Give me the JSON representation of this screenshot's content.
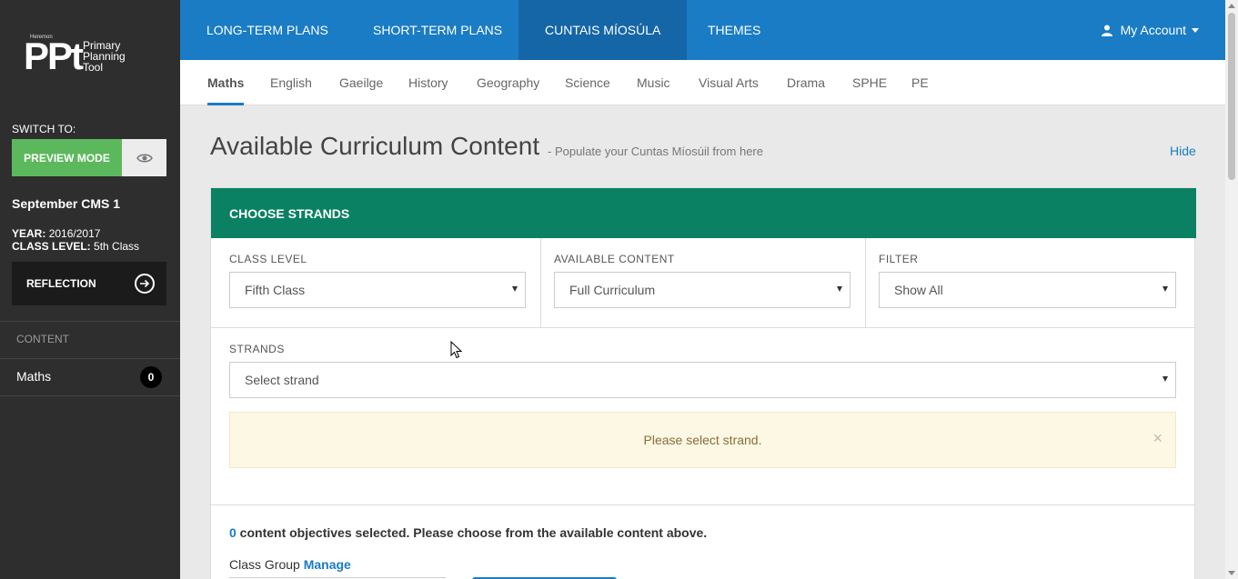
{
  "sidebar": {
    "logo": {
      "publisher": "Heremon",
      "mark": "PPt",
      "tagline": "Primary Planning Tool"
    },
    "switch_to_label": "SWITCH TO:",
    "preview_button": "PREVIEW MODE",
    "eye_icon": "eye-icon",
    "plan_title": "September CMS 1",
    "year_label": "YEAR:",
    "year_value": "2016/2017",
    "class_level_label": "CLASS LEVEL:",
    "class_level_value": "5th Class",
    "reflection_button": "REFLECTION",
    "content_label": "CONTENT",
    "content_items": [
      {
        "label": "Maths",
        "count": "0"
      }
    ]
  },
  "topnav": {
    "items": [
      {
        "label": "LONG-TERM PLANS"
      },
      {
        "label": "SHORT-TERM PLANS"
      },
      {
        "label": "CUNTAIS MÍOSÚLA",
        "active": true
      },
      {
        "label": "THEMES"
      }
    ],
    "account_label": "My Account"
  },
  "subject_tabs": [
    {
      "label": "Maths",
      "active": true
    },
    {
      "label": "English"
    },
    {
      "label": "Gaeilge"
    },
    {
      "label": "History"
    },
    {
      "label": "Geography"
    },
    {
      "label": "Science"
    },
    {
      "label": "Music"
    },
    {
      "label": "Visual Arts"
    },
    {
      "label": "Drama"
    },
    {
      "label": "SPHE"
    },
    {
      "label": "PE"
    }
  ],
  "main": {
    "title": "Available Curriculum Content",
    "subtitle": "- Populate your Cuntas Míosúil from here",
    "hide_link": "Hide",
    "panel_heading": "CHOOSE STRANDS",
    "class_level": {
      "label": "CLASS LEVEL",
      "value": "Fifth Class"
    },
    "available_content": {
      "label": "AVAILABLE CONTENT",
      "value": "Full Curriculum"
    },
    "filter": {
      "label": "FILTER",
      "value": "Show All"
    },
    "strands": {
      "label": "STRANDS",
      "value": "Select strand"
    },
    "alert_text": "Please select strand.",
    "alert_close": "×",
    "objectives_count": "0",
    "objectives_text": " content objectives selected. Please choose from the available content above.",
    "class_group_label": "Class Group",
    "manage_link": "Manage"
  },
  "colors": {
    "sidebar_bg": "#2e2e2e",
    "nav_blue": "#1a7cc4",
    "nav_active": "#1466a7",
    "panel_green": "#0a8162",
    "preview_green": "#5cb85c",
    "alert_bg": "#fcf8e3"
  }
}
